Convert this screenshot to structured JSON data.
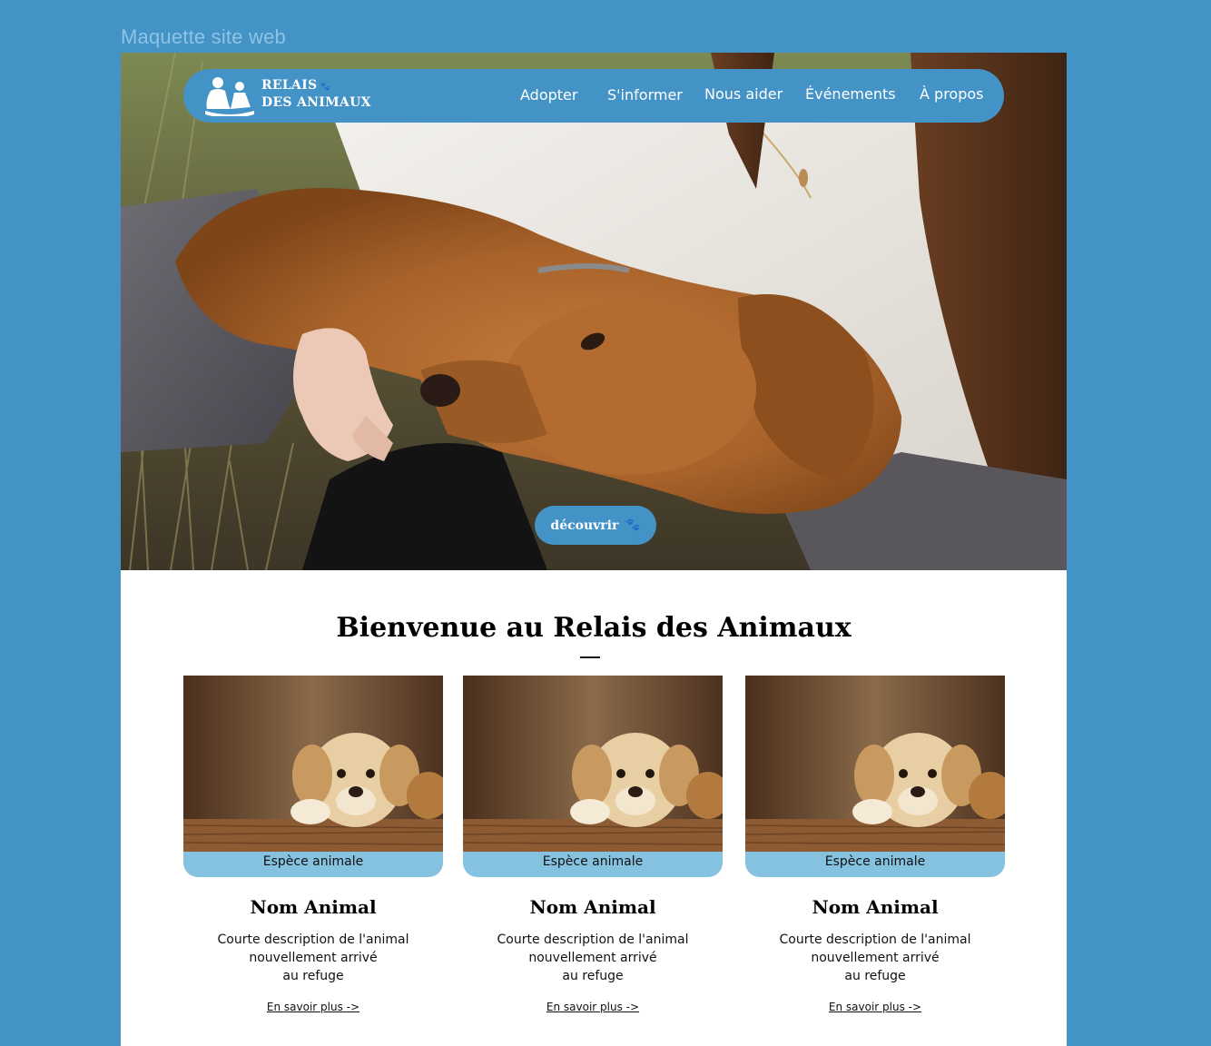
{
  "frame_label": "Maquette site web",
  "header": {
    "logo": {
      "line1": "RELAIS",
      "line2": "DES ANIMAUX",
      "icon": "family-pet-logo-icon"
    },
    "nav": [
      {
        "label": "Adopter"
      },
      {
        "label": "S'informer"
      },
      {
        "label": "Nous aider"
      },
      {
        "label": "Événements"
      },
      {
        "label": "À propos"
      }
    ]
  },
  "hero": {
    "image": "woman-hugging-golden-dog-photo",
    "cta_label": "découvrir",
    "cta_icon": "paw-icon"
  },
  "welcome": {
    "title": "Bienvenue au Relais des Animaux"
  },
  "cards": [
    {
      "species": "Espèce animale",
      "name": "Nom Animal",
      "desc": [
        "Courte description de l'animal",
        "nouvellement arrivé",
        "au refuge"
      ],
      "link": "En savoir plus ->",
      "image": "puppy-photo"
    },
    {
      "species": "Espèce animale",
      "name": "Nom Animal",
      "desc": [
        "Courte description de l'animal",
        "nouvellement arrivé",
        "au refuge"
      ],
      "link": "En savoir plus ->",
      "image": "puppy-photo"
    },
    {
      "species": "Espèce animale",
      "name": "Nom Animal",
      "desc": [
        "Courte description de l'animal",
        "nouvellement arrivé",
        "au refuge"
      ],
      "link": "En savoir plus ->",
      "image": "puppy-photo"
    }
  ],
  "colors": {
    "brand_blue": "#4493c7",
    "light_blue": "#84c2e0",
    "page_bg": "#ffffff"
  }
}
